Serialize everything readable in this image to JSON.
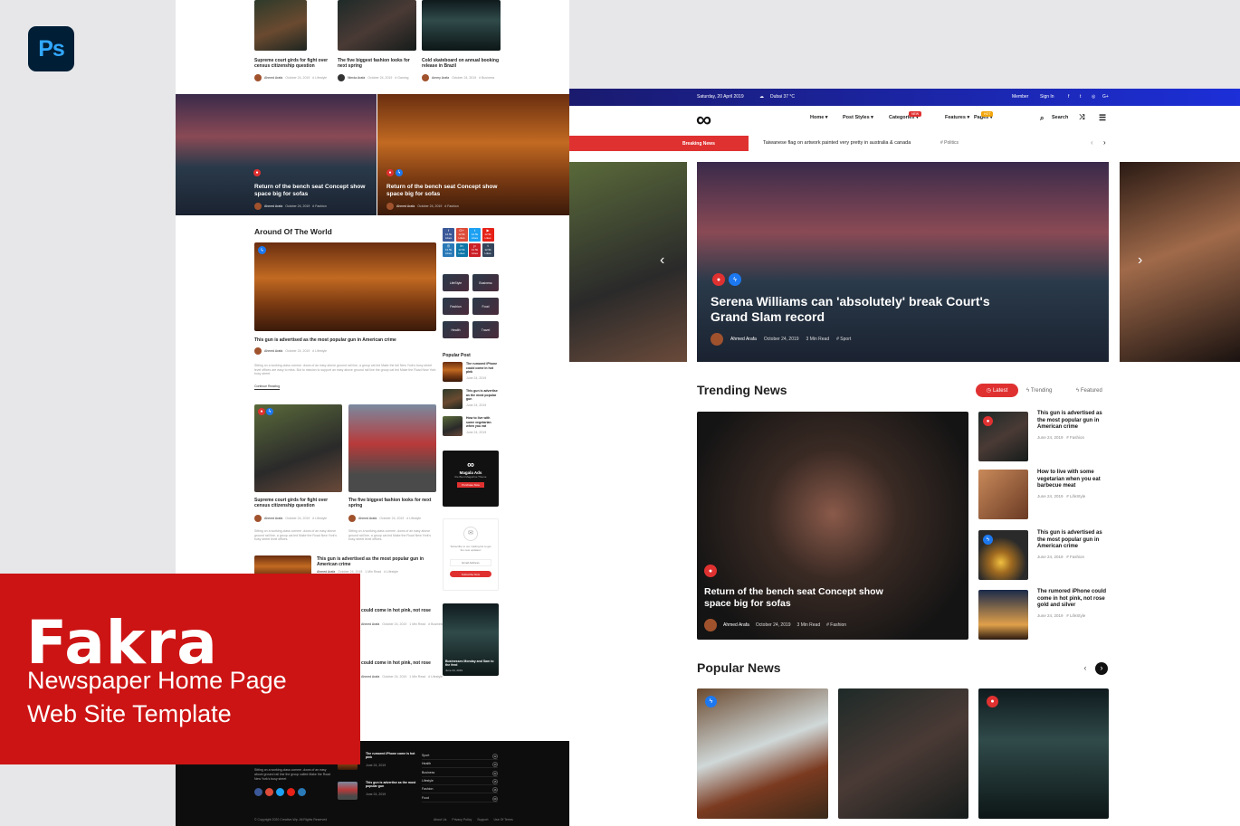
{
  "app_icon": "Ps",
  "promo": {
    "title": "Fakra",
    "line1": "Newspaper Home Page",
    "line2": "Web Site Template"
  },
  "left": {
    "top_cards": [
      {
        "title": "Supreme court girds for fight over census citizenship question",
        "author": "Ahmed Arafa",
        "date": "October 24, 2019",
        "cat": "# Lifestyle"
      },
      {
        "title": "The five biggest fashion looks for next spring",
        "author": "Nimda Arafa",
        "date": "October 24, 2019",
        "cat": "# Gaming"
      },
      {
        "title": "Cold skateboard on annual booking release in Brazil",
        "author": "Ammy Arafa",
        "date": "October 24, 2019",
        "cat": "# Business"
      }
    ],
    "heroes": [
      {
        "title": "Return of the bench seat Concept show space big for sofas",
        "author": "Ahmed Arafa",
        "date": "October 24, 2019",
        "cat": "# Fashion"
      },
      {
        "title": "Return of the bench seat Concept show space big for sofas",
        "author": "Ahmed Arafa",
        "date": "October 24, 2019",
        "cat": "# Fashion"
      }
    ],
    "around_title": "Around Of The World",
    "around_main": {
      "title": "This gun is advertised as the most popular gun in American crime",
      "author": "Ahmed Arafa",
      "date": "October 24, 2019",
      "cat": "# Lifestyle",
      "text": "Sitting on a working-class comme -dows of an easy above ground rail line, a group cat led Make the full New York's busy street level offices are easy to miss. But to mission to support an easy above ground rail line the group cat led Make the Road New York busy street.",
      "more": "Continue Reading"
    },
    "grid_cards": [
      {
        "title": "Supreme court girds for fight over census citizenship question",
        "author": "Ahmed Arafa",
        "date": "October 24, 2019",
        "cat": "# Lifestyle",
        "text": "Sitting on a working-class comme -dows of an easy above ground rail line, a group cat led Make the Road New York's busy street level offices."
      },
      {
        "title": "The five biggest fashion looks for next spring",
        "author": "Ahmed Arafa",
        "date": "October 24, 2019",
        "cat": "# Lifestyle",
        "text": "Sitting on a working-class comme -dows of an easy above ground rail line, a group cat led Make the Road New York's busy street level offices."
      }
    ],
    "list_items": [
      {
        "title": "This gun is advertised as the most popular gun in American crime",
        "author": "Ahmed Arafa",
        "date": "October 24, 2019",
        "meta": "1 Min Read",
        "cat": "# Lifestyle"
      },
      {
        "title": "could come in hot pink, not rose",
        "author": "Ahmed Arafa",
        "date": "October 24, 2019",
        "meta": "1 Min Read",
        "cat": "# Business"
      },
      {
        "title": "could come in hot pink, not rose",
        "author": "Ahmed Arafa",
        "date": "October 24, 2019",
        "meta": "1 Min Read",
        "cat": "# Lifestyle"
      }
    ],
    "social": [
      {
        "n": "f",
        "c": "#3b5998",
        "v": "12.5k",
        "l": "Likes"
      },
      {
        "n": "G+",
        "c": "#dd4b39",
        "v": "12.5k",
        "l": "Likes"
      },
      {
        "n": "t",
        "c": "#1da1f2",
        "v": "12.5k",
        "l": "Likes"
      },
      {
        "n": "▶",
        "c": "#e62117",
        "v": "12.5k",
        "l": "Likes"
      },
      {
        "n": "◎",
        "c": "#2a7ab8",
        "v": "12.5k",
        "l": "Likes"
      },
      {
        "n": "in",
        "c": "#0e76a8",
        "v": "12.5k",
        "l": "Likes"
      },
      {
        "n": "p",
        "c": "#cb2027",
        "v": "12.5k",
        "l": "Likes"
      },
      {
        "n": "t",
        "c": "#35465c",
        "v": "12.5k",
        "l": "Likes"
      }
    ],
    "categories": [
      "LifeStyle",
      "Business",
      "Fashion",
      "Food",
      "Health",
      "Travel"
    ],
    "popular_title": "Popular Post",
    "popular": [
      {
        "title": "The rumored iPhone could come in hot pink",
        "date": "June 24, 2019"
      },
      {
        "title": "This gun is advertise as the most popular gun",
        "date": "June 24, 2019"
      },
      {
        "title": "How to live with some vegetarian when you eat",
        "date": "June 24, 2019"
      }
    ],
    "ads": {
      "title": "Magala Ads",
      "sub": "the Best Magazine Theme",
      "btn": "Purchase Now"
    },
    "newsletter": {
      "text": "Subscribe to our mailing list to get the new updates!",
      "placeholder": "Email Address",
      "btn": "Subscribe Now"
    },
    "slide_card": {
      "title": "Businesses Monday and Sam to the feed",
      "date": "June 24, 2019"
    },
    "footer": {
      "about": "Sitting on a working-class comme -dows of an easy above ground rail line the group called Make the Road New York's busy street",
      "posts": [
        {
          "title": "The rumored iPhone come is hot pink",
          "date": "June 24, 2019",
          "cat": "# Lifestyle"
        },
        {
          "title": "This gun is advertise as the most popular gun",
          "date": "June 24, 2019",
          "cat": "# Gaming"
        }
      ],
      "cats": [
        "Sport",
        "Health",
        "Business",
        "Lifestyle",
        "Fashion",
        "Food"
      ],
      "counts": [
        "12",
        "10",
        "22",
        "15",
        "16",
        "09"
      ],
      "copyright": "© Copyright 2020 Creative-Wp. All Rights Reserved",
      "links": [
        "About Us",
        "Privacy Policy",
        "Support",
        "Use Of Terms"
      ]
    }
  },
  "right": {
    "top": {
      "date": "Saturday, 20 April 2019",
      "weather": "Dubai  37 °C",
      "member": "Member",
      "signin": "Sign In"
    },
    "nav": [
      "Home",
      "Post Styles",
      "Categories",
      "Features",
      "Pages"
    ],
    "nav_badges": {
      "categories": "NEW",
      "pages": "HOT"
    },
    "search": "Search",
    "breaking_label": "Breaking News",
    "breaking_text": "Taiwanese flag on artwork painted very pretty in australia & canada",
    "breaking_cat": "# Politics",
    "hero": {
      "title": "Serena Williams can 'absolutely' break Court's Grand Slam record",
      "author": "Ahmed Arafa",
      "date": "October 24, 2019",
      "read": "3 Min Read",
      "cat": "# Sport"
    },
    "trending_title": "Trending News",
    "tabs": [
      "Latest",
      "Trending",
      "Featured"
    ],
    "trend_main": {
      "title": "Return of the bench seat Concept show space big for sofas",
      "author": "Ahmed Arafa",
      "date": "October 24, 2019",
      "read": "3 Min Read",
      "cat": "# Fashion"
    },
    "trend_side": [
      {
        "title": "This gun is advertised as the most popular gun in American crime",
        "date": "June 24, 2019",
        "cat": "# Fashion"
      },
      {
        "title": "How to live with some vegetarian when you eat barbecue meat",
        "date": "June 24, 2019",
        "cat": "# LifeStyle"
      },
      {
        "title": "This gun is advertised as the most popular gun in American crime",
        "date": "June 24, 2019",
        "cat": "# Fashion"
      },
      {
        "title": "The rumored iPhone could come in hot pink, not rose gold and silver",
        "date": "June 24, 2019",
        "cat": "# LifeStyle"
      }
    ],
    "popular_title": "Popular News"
  },
  "colors": {
    "accent": "#e03131",
    "blue": "#1c78f0",
    "topbar": "#1c2fd8",
    "promo": "#cc1414"
  }
}
